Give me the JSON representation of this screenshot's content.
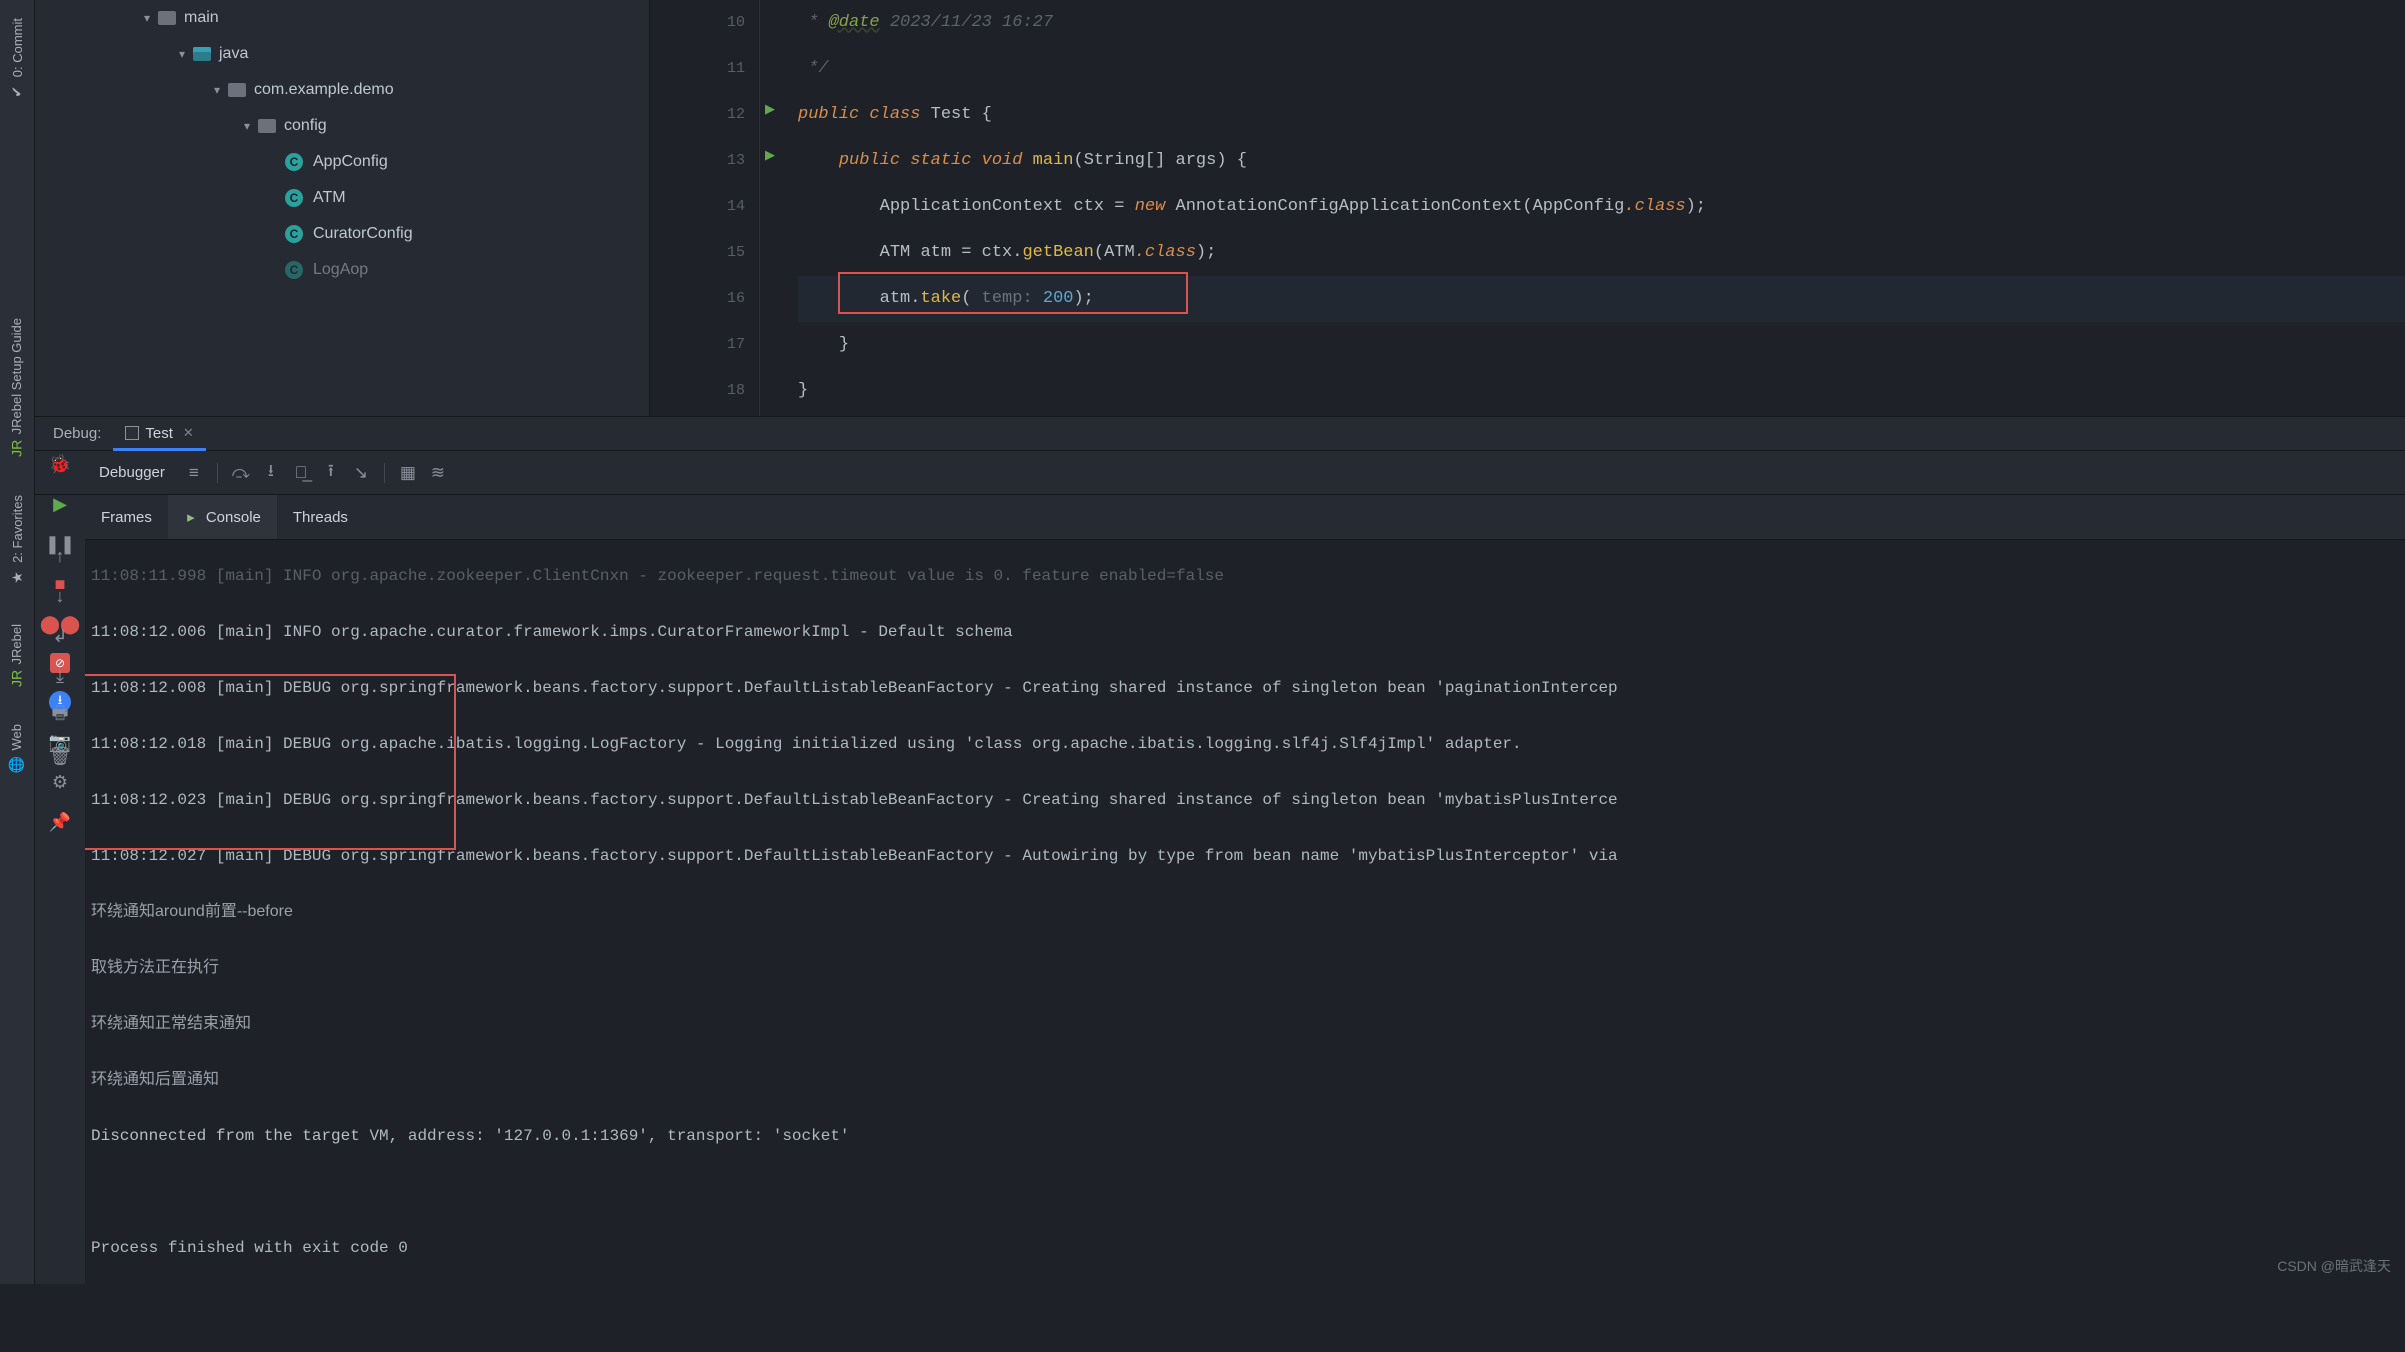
{
  "left_strip": {
    "commit": "Commit",
    "commit_prefix": "0:",
    "setup": "JRebel Setup Guide",
    "favorites": "2: Favorites",
    "jrebel": "JRebel",
    "web": "Web"
  },
  "project": {
    "items": [
      {
        "indent": 105,
        "chev": "▾",
        "icon": "folder-grey",
        "label": "main"
      },
      {
        "indent": 140,
        "chev": "▾",
        "icon": "folder-teal",
        "label": "java"
      },
      {
        "indent": 175,
        "chev": "▾",
        "icon": "folder-grey",
        "label": "com.example.demo"
      },
      {
        "indent": 205,
        "chev": "▾",
        "icon": "folder-grey",
        "label": "config"
      },
      {
        "indent": 250,
        "chev": "",
        "icon": "class",
        "label": "AppConfig"
      },
      {
        "indent": 250,
        "chev": "",
        "icon": "class",
        "label": "ATM"
      },
      {
        "indent": 250,
        "chev": "",
        "icon": "class",
        "label": "CuratorConfig"
      },
      {
        "indent": 250,
        "chev": "",
        "icon": "class",
        "label": "LogAop"
      }
    ]
  },
  "gutter": [
    "10",
    "11",
    "12",
    "13",
    "14",
    "15",
    "16",
    "17",
    "18"
  ],
  "play_rows": [
    2,
    3
  ],
  "code": {
    "cmt_tag": "@date",
    "cmt_date": "2023/11/23 16:27",
    "cmt_end": "*/",
    "kw_public": "public",
    "kw_class": "class",
    "kw_static": "static",
    "kw_void": "void",
    "kw_new": "new",
    "cls_Test": "Test",
    "fn_main": "main",
    "typ_StringArr": "String[]",
    "var_args": "args",
    "typ_AppCtx": "ApplicationContext",
    "var_ctx": "ctx",
    "cls_AnnoCfg": "AnnotationConfigApplicationContext",
    "cls_AppConfig": "AppConfig",
    "kw_classref": ".class",
    "typ_ATM": "ATM",
    "var_atm": "atm",
    "fn_getBean": "getBean",
    "fn_take": "take",
    "hint_temp": "temp:",
    "num_200": "200"
  },
  "debug": {
    "title": "Debug:",
    "tab": "Test",
    "debugger": "Debugger",
    "frames": "Frames",
    "console": "Console",
    "threads": "Threads"
  },
  "console": {
    "lines": [
      "11:08:11.998 [main] INFO org.apache.zookeeper.ClientCnxn - zookeeper.request.timeout value is 0. feature enabled=false",
      "11:08:12.006 [main] INFO org.apache.curator.framework.imps.CuratorFrameworkImpl - Default schema",
      "11:08:12.008 [main] DEBUG org.springframework.beans.factory.support.DefaultListableBeanFactory - Creating shared instance of singleton bean 'paginationIntercep",
      "11:08:12.018 [main] DEBUG org.apache.ibatis.logging.LogFactory - Logging initialized using 'class org.apache.ibatis.logging.slf4j.Slf4jImpl' adapter.",
      "11:08:12.023 [main] DEBUG org.springframework.beans.factory.support.DefaultListableBeanFactory - Creating shared instance of singleton bean 'mybatisPlusInterce",
      "11:08:12.027 [main] DEBUG org.springframework.beans.factory.support.DefaultListableBeanFactory - Autowiring by type from bean name 'mybatisPlusInterceptor' via"
    ],
    "cn1": "环绕通知around前置--before",
    "cn2": "取钱方法正在执行",
    "cn3": "环绕通知正常结束通知",
    "cn4": "环绕通知后置通知",
    "disc_a": "Disconnected from the target",
    "disc_b": " VM, address: '127.0.0.1:1369', transport: 'socket'",
    "exit": "Process finished with exit code 0"
  },
  "watermark": "CSDN @暗武逢天"
}
